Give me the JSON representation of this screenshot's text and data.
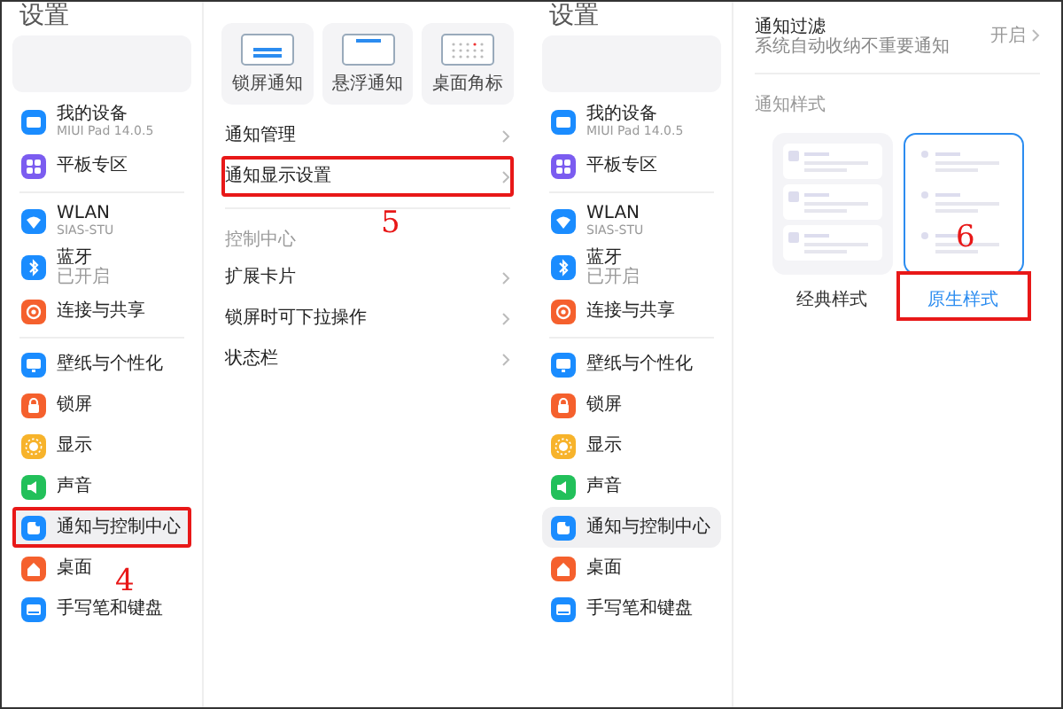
{
  "screens": [
    {
      "sidebar": {
        "title": "设置",
        "groups": [
          {
            "items": [
              {
                "label": "我的设备",
                "sublabel": "MIUI Pad 14.0.5",
                "selected": false
              },
              {
                "label": "平板专区",
                "selected": false
              }
            ]
          },
          {
            "items": [
              {
                "label": "WLAN",
                "sublabel": "SIAS-STU",
                "selected": false
              },
              {
                "label": "蓝牙",
                "sublabel": "已开启",
                "selected": false
              },
              {
                "label": "连接与共享",
                "selected": false
              }
            ]
          },
          {
            "items": [
              {
                "label": "壁纸与个性化",
                "selected": false
              },
              {
                "label": "锁屏",
                "selected": false
              },
              {
                "label": "显示",
                "selected": false
              },
              {
                "label": "声音",
                "selected": false
              },
              {
                "label": "通知与控制中心",
                "selected": true,
                "annotation": "4"
              },
              {
                "label": "桌面",
                "selected": false
              },
              {
                "label": "手写笔和键盘",
                "selected": false
              }
            ]
          }
        ]
      },
      "content": [
        {
          "kind": "tiles",
          "tiles": [
            {
              "label": "锁屏通知"
            },
            {
              "label": "悬浮通知"
            },
            {
              "label": "桌面角标"
            }
          ]
        },
        {
          "kind": "row",
          "label": "通知管理"
        },
        {
          "kind": "row",
          "label": "通知显示设置",
          "annotation": "5"
        },
        {
          "kind": "header",
          "label": "控制中心"
        },
        {
          "kind": "row",
          "label": "扩展卡片"
        },
        {
          "kind": "row",
          "label": "锁屏时可下拉操作"
        },
        {
          "kind": "row",
          "label": "状态栏"
        }
      ]
    },
    {
      "sidebar": {
        "title": "设置",
        "groups": [
          {
            "items": [
              {
                "label": "我的设备",
                "sublabel": "MIUI Pad 14.0.5",
                "selected": false
              },
              {
                "label": "平板专区",
                "selected": false
              }
            ]
          },
          {
            "items": [
              {
                "label": "WLAN",
                "sublabel": "SIAS-STU",
                "selected": false
              },
              {
                "label": "蓝牙",
                "sublabel": "已开启",
                "selected": false
              },
              {
                "label": "连接与共享",
                "selected": false
              }
            ]
          },
          {
            "items": [
              {
                "label": "壁纸与个性化",
                "selected": false
              },
              {
                "label": "锁屏",
                "selected": false
              },
              {
                "label": "显示",
                "selected": false
              },
              {
                "label": "声音",
                "selected": false
              },
              {
                "label": "通知与控制中心",
                "selected": true
              },
              {
                "label": "桌面",
                "selected": false
              },
              {
                "label": "手写笔和键盘",
                "selected": false
              }
            ]
          }
        ]
      },
      "content": [
        {
          "kind": "row",
          "label": "通知过滤",
          "sublabel": "系统自动收纳不重要通知",
          "value": "开启"
        },
        {
          "kind": "header",
          "label": "通知样式"
        },
        {
          "kind": "styles",
          "options": [
            {
              "label": "经典样式",
              "selected": false
            },
            {
              "label": "原生样式",
              "selected": true,
              "annotation": "6"
            }
          ]
        }
      ]
    }
  ]
}
